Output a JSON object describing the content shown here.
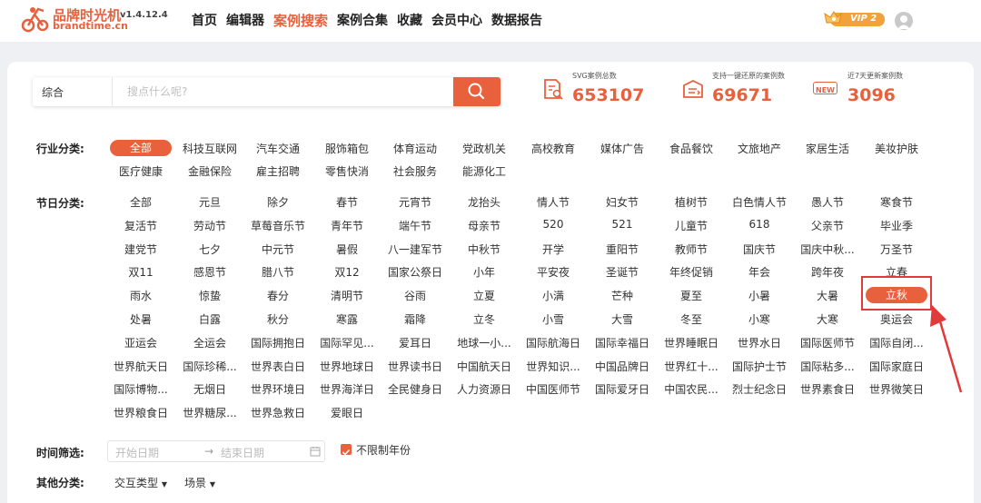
{
  "header": {
    "brand_cn": "品牌时光机",
    "brand_en": "brandtime.cn",
    "version": "v1.4.12.4",
    "nav": [
      {
        "label": "首页",
        "active": false
      },
      {
        "label": "编辑器",
        "active": false
      },
      {
        "label": "案例搜索",
        "active": true
      },
      {
        "label": "案例合集",
        "active": false
      },
      {
        "label": "收藏",
        "active": false
      },
      {
        "label": "会员中心",
        "active": false
      },
      {
        "label": "数据报告",
        "active": false
      }
    ],
    "vip_label": "VIP 2"
  },
  "search": {
    "type": "综合",
    "placeholder": "搜点什么呢?"
  },
  "stats": [
    {
      "label": "SVG案例总数",
      "value": "653107",
      "icon": "document-search-icon"
    },
    {
      "label": "支持一键还原的案例数",
      "value": "69671",
      "icon": "restore-icon"
    },
    {
      "label": "近7天更新案例数",
      "value": "3096",
      "icon": "new-badge-icon",
      "badge": "NEW"
    }
  ],
  "industry": {
    "label": "行业分类:",
    "rows": [
      [
        "全部",
        "科技互联网",
        "汽车交通",
        "服饰箱包",
        "体育运动",
        "党政机关",
        "高校教育",
        "媒体广告",
        "食品餐饮",
        "文旅地产",
        "家居生活",
        "美妆护肤"
      ],
      [
        "医疗健康",
        "金融保险",
        "雇主招聘",
        "零售快消",
        "社会服务",
        "能源化工"
      ]
    ]
  },
  "festival": {
    "label": "节日分类:",
    "rows": [
      [
        "全部",
        "元旦",
        "除夕",
        "春节",
        "元宵节",
        "龙抬头",
        "情人节",
        "妇女节",
        "植树节",
        "白色情人节",
        "愚人节",
        "寒食节"
      ],
      [
        "复活节",
        "劳动节",
        "草莓音乐节",
        "青年节",
        "端午节",
        "母亲节",
        "520",
        "521",
        "儿童节",
        "618",
        "父亲节",
        "毕业季"
      ],
      [
        "建党节",
        "七夕",
        "中元节",
        "暑假",
        "八一建军节",
        "中秋节",
        "开学",
        "重阳节",
        "教师节",
        "国庆节",
        "国庆中秋...",
        "万圣节"
      ],
      [
        "双11",
        "感恩节",
        "腊八节",
        "双12",
        "国家公祭日",
        "小年",
        "平安夜",
        "圣诞节",
        "年终促销",
        "年会",
        "跨年夜",
        "立春"
      ],
      [
        "雨水",
        "惊蛰",
        "春分",
        "清明节",
        "谷雨",
        "立夏",
        "小满",
        "芒种",
        "夏至",
        "小暑",
        "大暑",
        "立秋"
      ],
      [
        "处暑",
        "白露",
        "秋分",
        "寒露",
        "霜降",
        "立冬",
        "小雪",
        "大雪",
        "冬至",
        "小寒",
        "大寒",
        "奥运会"
      ],
      [
        "亚运会",
        "全运会",
        "国际拥抱日",
        "国际罕见...",
        "爱耳日",
        "地球一小...",
        "国际航海日",
        "国际幸福日",
        "世界睡眠日",
        "世界水日",
        "国际医师节",
        "国际自闭..."
      ],
      [
        "世界航天日",
        "国际珍稀...",
        "世界表白日",
        "世界地球日",
        "世界读书日",
        "中国航天日",
        "世界知识...",
        "中国品牌日",
        "世界红十...",
        "国际护士节",
        "国际粘多...",
        "国际家庭日"
      ],
      [
        "国际博物...",
        "无烟日",
        "世界环境日",
        "世界海洋日",
        "全民健身日",
        "人力资源日",
        "中国医师节",
        "国际爱牙日",
        "中国农民...",
        "烈士纪念日",
        "世界素食日",
        "世界微笑日"
      ],
      [
        "世界粮食日",
        "世界糖尿...",
        "世界急救日",
        "爱眼日"
      ]
    ]
  },
  "time_filter": {
    "label": "时间筛选:",
    "start_placeholder": "开始日期",
    "arrow": "→",
    "end_placeholder": "结束日期",
    "no_limit_label": "不限制年份",
    "no_limit_checked": true
  },
  "other": {
    "label": "其他分类:",
    "dropdowns": [
      "交互类型",
      "场景"
    ]
  },
  "colors": {
    "accent": "#e8603c",
    "annotation_red": "#e23a3a",
    "vip_gold": "#f2a23a"
  }
}
